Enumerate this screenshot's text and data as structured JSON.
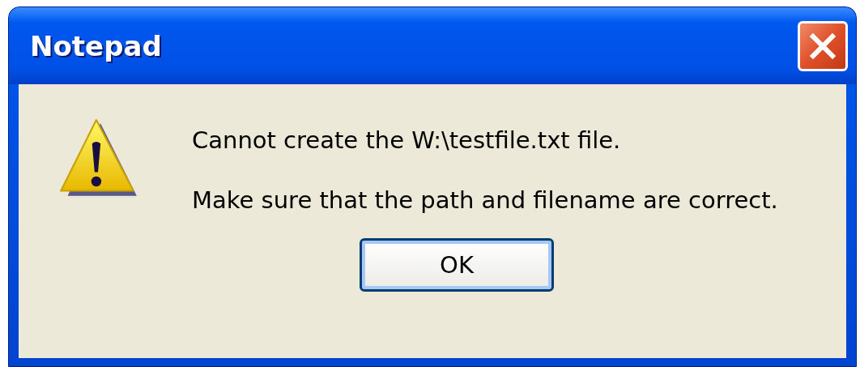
{
  "window": {
    "title": "Notepad"
  },
  "message": {
    "lines": [
      "Cannot create the W:\\testfile.txt file.",
      "Make sure that the path and filename are correct."
    ]
  },
  "buttons": [
    "OK"
  ]
}
